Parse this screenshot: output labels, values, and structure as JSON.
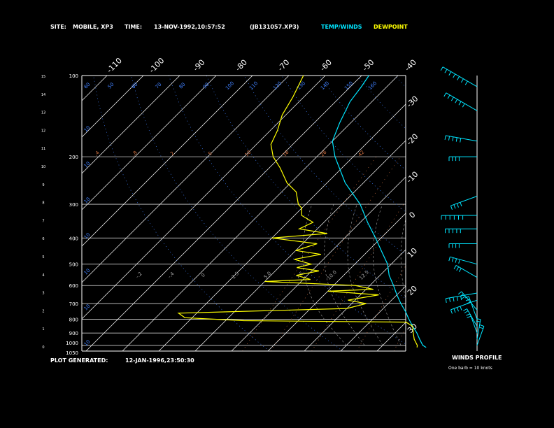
{
  "header": {
    "site_label": "SITE:",
    "site_value": "MOBILE, XP3",
    "time_label": "TIME:",
    "time_value": "13-NOV-1992,10:57:52",
    "file_id": "(JB131057.XP3)",
    "temp_winds_label": "TEMP/WINDS",
    "dewpoint_label": "DEWPOINT"
  },
  "footer": {
    "plot_generated_label": "PLOT GENERATED:",
    "plot_generated_value": "12-JAN-1996,23:50:30",
    "winds_profile_label": "WINDS PROFILE",
    "barb_note": "One barb = 10 knots"
  },
  "colors": {
    "background": "#000000",
    "text": "#ffffff",
    "temp_winds": "#00e5ff",
    "dewpoint": "#ffff00",
    "isobar": "#d0d0d0",
    "isotherm": "#ffffff",
    "mixing_ratio": "#d07040",
    "dry_adiabat": "#4080ff",
    "moist_adiabat": "#a0a0a0"
  },
  "chart_data": {
    "type": "line",
    "title": "",
    "xlabel": "",
    "ylabel": "",
    "x_scale": "skewed temperature (C)",
    "y_scale": "log pressure (mb)",
    "pressure_ticks": [
      "1050",
      "1000",
      "900",
      "800",
      "700",
      "600",
      "500",
      "400",
      "300",
      "200",
      "100"
    ],
    "height_ticks": [
      "0",
      "1",
      "2",
      "3",
      "4",
      "5",
      "6",
      "7",
      "8",
      "9",
      "10",
      "11",
      "12",
      "13",
      "14",
      "15"
    ],
    "top_temperature_ticks": [
      "-110",
      "-100",
      "-90",
      "-80",
      "-70",
      "-60",
      "-50",
      "-40"
    ],
    "right_temperature_ticks": [
      "-30",
      "-20",
      "-10",
      "0",
      "10",
      "20",
      "30"
    ],
    "mixing_ratio_labels": [
      ".4",
      ".8",
      "2",
      "5",
      "10",
      "16",
      "26",
      "42"
    ],
    "adiabat_labels_top": [
      "60",
      "50",
      "60",
      "70",
      "80",
      "90",
      "100",
      "110",
      "120",
      "130",
      "140",
      "150",
      "160"
    ],
    "adiabat_labels_left": [
      "10",
      "10",
      "10",
      "10",
      "10",
      "10",
      "10"
    ],
    "moist_labels": [
      "-.2",
      "-.4",
      "0",
      "2.5",
      "5.0",
      "7.5",
      "10.0",
      "12.5"
    ],
    "grid": true,
    "series": [
      {
        "name": "TEMP/WINDS",
        "color": "#00e5ff",
        "points": [
          {
            "p": 1018,
            "t": 22.5
          },
          {
            "p": 1000,
            "t": 21
          },
          {
            "p": 950,
            "t": 18.5
          },
          {
            "p": 900,
            "t": 16
          },
          {
            "p": 850,
            "t": 13
          },
          {
            "p": 800,
            "t": 10
          },
          {
            "p": 750,
            "t": 7
          },
          {
            "p": 700,
            "t": 3.5
          },
          {
            "p": 650,
            "t": 0
          },
          {
            "p": 600,
            "t": -3.5
          },
          {
            "p": 550,
            "t": -7.5
          },
          {
            "p": 500,
            "t": -11
          },
          {
            "p": 450,
            "t": -16
          },
          {
            "p": 400,
            "t": -21.5
          },
          {
            "p": 350,
            "t": -28
          },
          {
            "p": 300,
            "t": -35
          },
          {
            "p": 250,
            "t": -45
          },
          {
            "p": 200,
            "t": -55
          },
          {
            "p": 175,
            "t": -60
          },
          {
            "p": 150,
            "t": -63
          },
          {
            "p": 125,
            "t": -66
          },
          {
            "p": 110,
            "t": -67
          },
          {
            "p": 100,
            "t": -68
          }
        ]
      },
      {
        "name": "DEWPOINT",
        "color": "#ffff00",
        "points": [
          {
            "p": 1018,
            "t": 20
          },
          {
            "p": 1000,
            "t": 19.5
          },
          {
            "p": 950,
            "t": 17
          },
          {
            "p": 900,
            "t": 15
          },
          {
            "p": 850,
            "t": 13
          },
          {
            "p": 820,
            "t": 10
          },
          {
            "p": 810,
            "t": -35
          },
          {
            "p": 790,
            "t": -52
          },
          {
            "p": 760,
            "t": -55
          },
          {
            "p": 730,
            "t": -10
          },
          {
            "p": 700,
            "t": -6
          },
          {
            "p": 680,
            "t": -12
          },
          {
            "p": 650,
            "t": -5
          },
          {
            "p": 630,
            "t": -20
          },
          {
            "p": 620,
            "t": -8
          },
          {
            "p": 600,
            "t": -14
          },
          {
            "p": 580,
            "t": -40
          },
          {
            "p": 570,
            "t": -28
          },
          {
            "p": 550,
            "t": -33
          },
          {
            "p": 530,
            "t": -28
          },
          {
            "p": 515,
            "t": -35
          },
          {
            "p": 500,
            "t": -32
          },
          {
            "p": 480,
            "t": -38
          },
          {
            "p": 460,
            "t": -32
          },
          {
            "p": 445,
            "t": -40
          },
          {
            "p": 420,
            "t": -36
          },
          {
            "p": 400,
            "t": -50
          },
          {
            "p": 385,
            "t": -36
          },
          {
            "p": 370,
            "t": -45
          },
          {
            "p": 350,
            "t": -43
          },
          {
            "p": 330,
            "t": -48
          },
          {
            "p": 310,
            "t": -50
          },
          {
            "p": 300,
            "t": -52
          },
          {
            "p": 270,
            "t": -56
          },
          {
            "p": 250,
            "t": -61
          },
          {
            "p": 220,
            "t": -67
          },
          {
            "p": 200,
            "t": -72
          },
          {
            "p": 180,
            "t": -76
          },
          {
            "p": 160,
            "t": -78
          },
          {
            "p": 140,
            "t": -81
          },
          {
            "p": 120,
            "t": -83
          },
          {
            "p": 100,
            "t": -86
          }
        ]
      }
    ],
    "wind_barbs": [
      {
        "p": 110,
        "dir": 300,
        "knots": 70
      },
      {
        "p": 135,
        "dir": 300,
        "knots": 60
      },
      {
        "p": 175,
        "dir": 280,
        "knots": 50
      },
      {
        "p": 200,
        "dir": 270,
        "knots": 40
      },
      {
        "p": 280,
        "dir": 250,
        "knots": 40
      },
      {
        "p": 330,
        "dir": 270,
        "knots": 60
      },
      {
        "p": 370,
        "dir": 270,
        "knots": 50
      },
      {
        "p": 420,
        "dir": 270,
        "knots": 40
      },
      {
        "p": 500,
        "dir": 285,
        "knots": 40
      },
      {
        "p": 560,
        "dir": 300,
        "knots": 30
      },
      {
        "p": 640,
        "dir": 260,
        "knots": 50
      },
      {
        "p": 680,
        "dir": 250,
        "knots": 40
      },
      {
        "p": 740,
        "dir": 320,
        "knots": 30
      },
      {
        "p": 800,
        "dir": 340,
        "knots": 30
      },
      {
        "p": 850,
        "dir": 330,
        "knots": 20
      },
      {
        "p": 900,
        "dir": 340,
        "knots": 20
      },
      {
        "p": 950,
        "dir": 10,
        "knots": 20
      },
      {
        "p": 1000,
        "dir": 20,
        "knots": 20
      }
    ]
  }
}
